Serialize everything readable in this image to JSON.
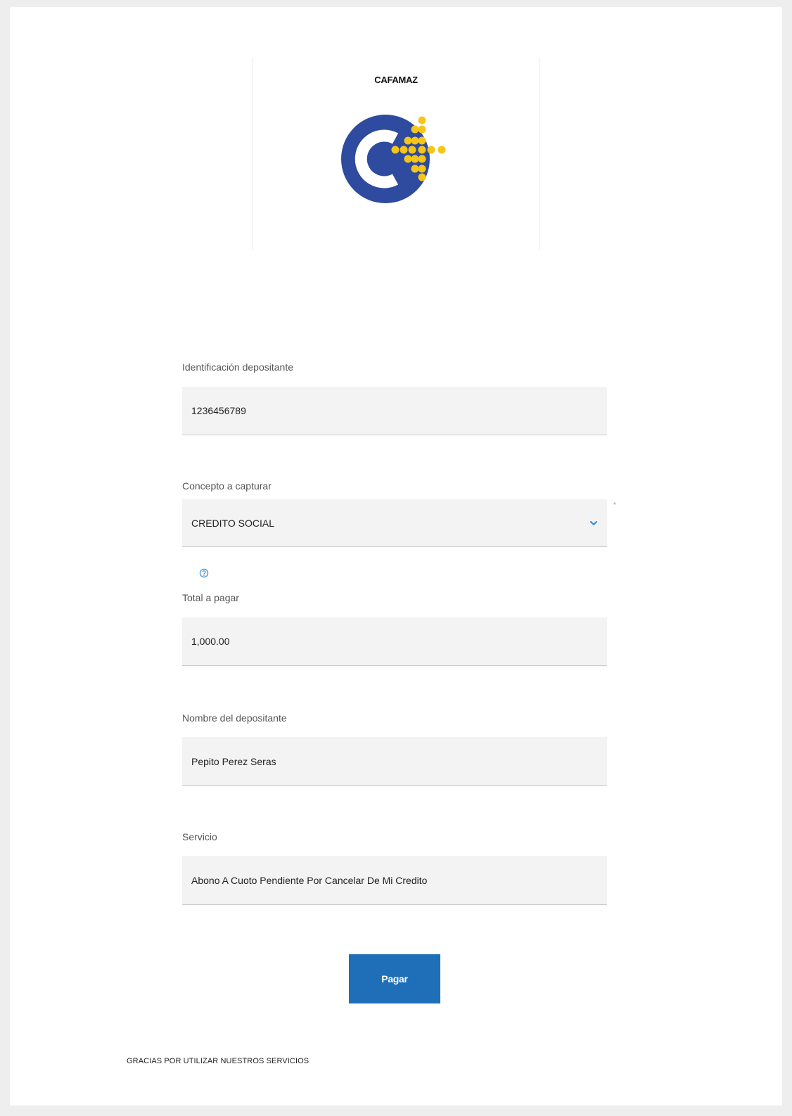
{
  "header": {
    "brand_name": "CAFAMAZ"
  },
  "form": {
    "identificacion": {
      "label": "Identificación depositante",
      "value": "1236456789"
    },
    "concepto": {
      "label": "Concepto a capturar",
      "selected": "CREDITO SOCIAL",
      "required_mark": "*"
    },
    "total": {
      "label": "Total a pagar",
      "value": "1,000.00"
    },
    "nombre": {
      "label": "Nombre del depositante",
      "value": "Pepito Perez Seras"
    },
    "servicio": {
      "label": "Servicio",
      "value": "Abono A Cuoto Pendiente Por Cancelar De Mi Credito"
    },
    "pay_button_label": "Pagar"
  },
  "footer": {
    "message": "GRACIAS POR UTILIZAR NUESTROS SERVICIOS"
  },
  "icons": {
    "logo": "cafamaz-logo",
    "select_arrow": "chevron-down-icon",
    "help": "help-circle-icon"
  },
  "colors": {
    "logo_blue": "#2f4b9f",
    "logo_dots": "#f5c518",
    "button": "#1f6fb8",
    "accent_blue": "#3a8fd6",
    "field_bg": "#f3f3f3"
  }
}
